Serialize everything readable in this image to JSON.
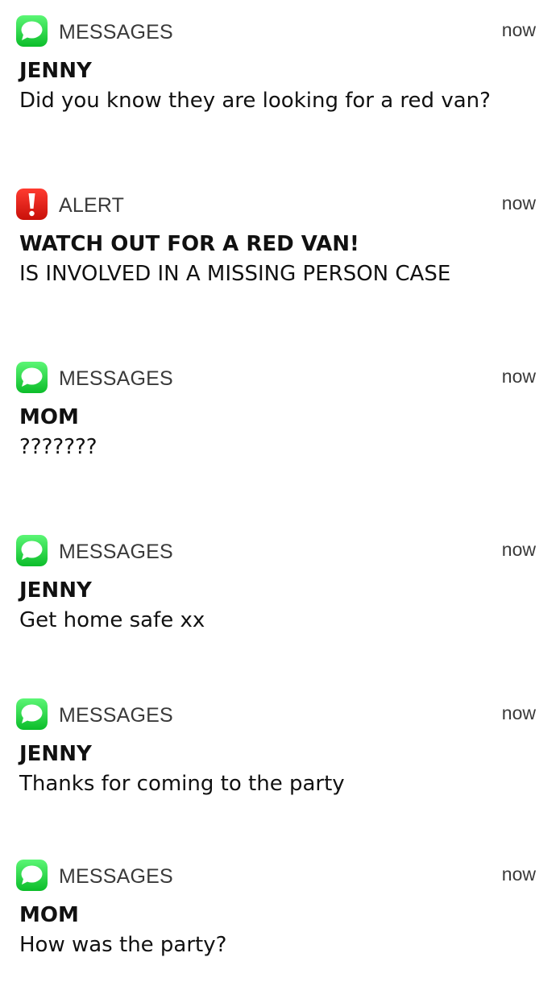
{
  "notifications": [
    {
      "app": "MESSAGES",
      "icon": "messages-icon",
      "time": "now",
      "sender": "JENNY",
      "body": "Did you know they are looking for a red van?"
    },
    {
      "app": "ALERT",
      "icon": "alert-icon",
      "time": "now",
      "sender": "WATCH OUT FOR A RED VAN!",
      "body": "IS INVOLVED IN A MISSING PERSON CASE"
    },
    {
      "app": "MESSAGES",
      "icon": "messages-icon",
      "time": "now",
      "sender": "MOM",
      "body": "???????"
    },
    {
      "app": "MESSAGES",
      "icon": "messages-icon",
      "time": "now",
      "sender": "JENNY",
      "body": "Get home safe xx"
    },
    {
      "app": "MESSAGES",
      "icon": "messages-icon",
      "time": "now",
      "sender": "JENNY",
      "body": "Thanks for coming to the party"
    },
    {
      "app": "MESSAGES",
      "icon": "messages-icon",
      "time": "now",
      "sender": "MOM",
      "body": "How was the party?"
    }
  ],
  "colors": {
    "messages_green_top": "#5BF675",
    "messages_green_bottom": "#0CBD2A",
    "alert_red_top": "#FF3B30",
    "alert_red_bottom": "#C8100A"
  }
}
